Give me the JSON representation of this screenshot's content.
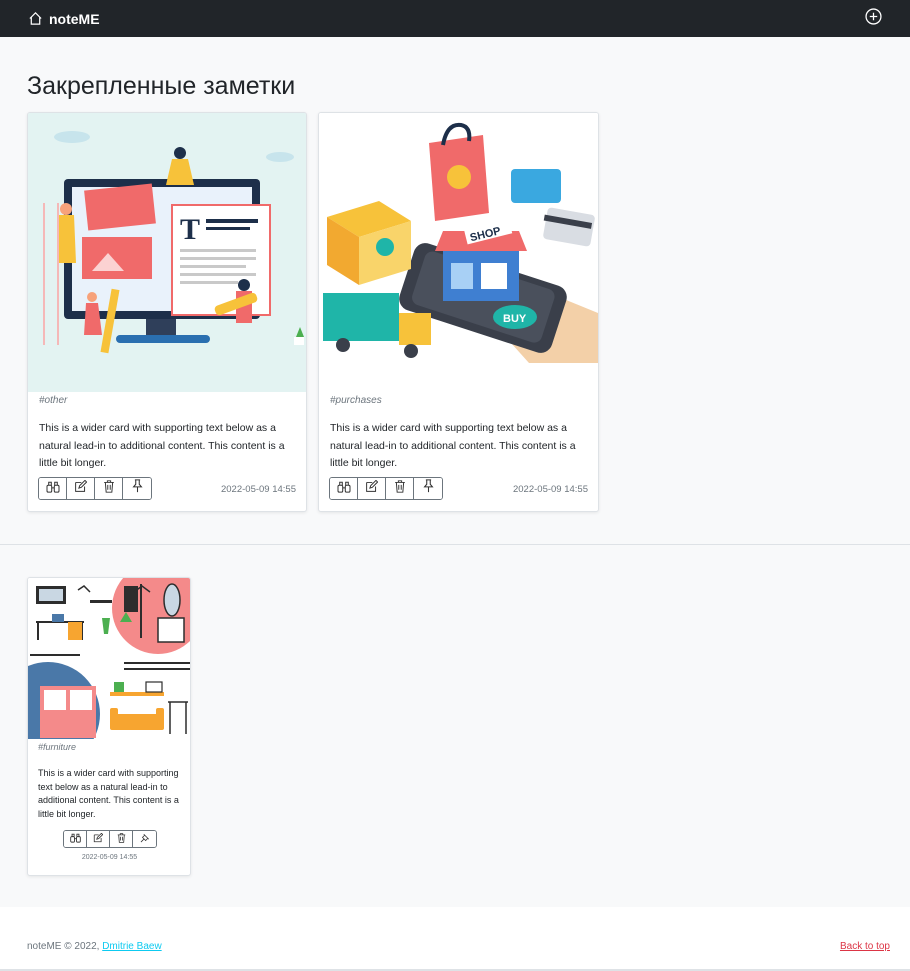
{
  "navbar": {
    "brand": "noteME",
    "brand_icon": "home-icon",
    "add_icon": "plus-circle-icon"
  },
  "pinned": {
    "title": "Закрепленные заметки"
  },
  "cards": [
    {
      "tag": "#other",
      "text": "This is a wider card with supporting text below as a natural lead-in to additional content. This content is a little bit longer.",
      "date": "2022-05-09 14:55",
      "image": "web-design-illustration"
    },
    {
      "tag": "#purchases",
      "text": "This is a wider card with supporting text below as a natural lead-in to additional content. This content is a little bit longer.",
      "date": "2022-05-09 14:55",
      "image": "online-shopping-illustration"
    },
    {
      "tag": "#furniture",
      "text": "This is a wider card with supporting text below as a natural lead-in to additional content. This content is a little bit longer.",
      "date": "2022-05-09 14:55",
      "image": "furniture-interior-illustration"
    }
  ],
  "actions": [
    "binoculars-icon",
    "edit-icon",
    "trash-icon",
    "pin-icon"
  ],
  "footer": {
    "copyright": "noteME © 2022,",
    "author": "Dmitrie Baew",
    "back_to_top": "Back to top"
  },
  "colors": {
    "navbar": "#212529",
    "accent_link": "#0dcaf0",
    "back_to_top": "#dc3545"
  }
}
